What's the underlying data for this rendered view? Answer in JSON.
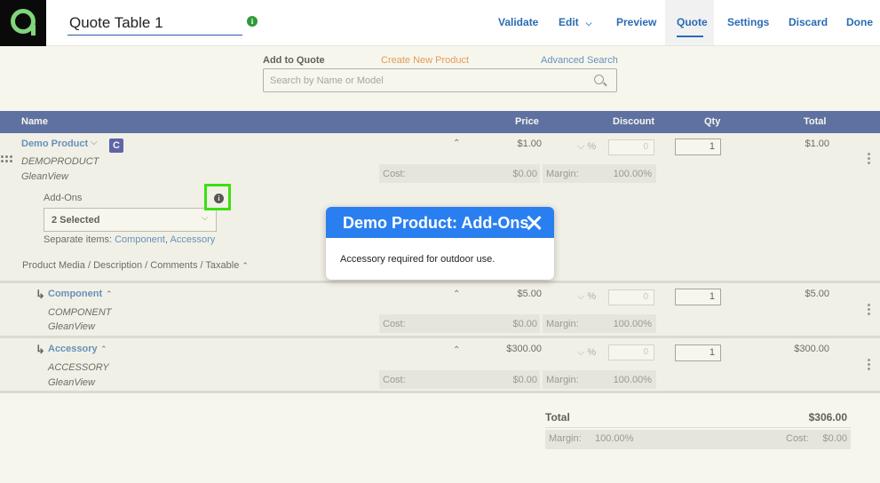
{
  "header": {
    "title_value": "Quote Table 1",
    "nav": {
      "validate": "Validate",
      "edit": "Edit",
      "preview": "Preview",
      "quote": "Quote",
      "settings": "Settings",
      "discard": "Discard",
      "done": "Done"
    },
    "active_tab": "Quote"
  },
  "add_to_quote": {
    "label": "Add to Quote",
    "create_new": "Create New Product",
    "advanced_search": "Advanced Search",
    "search_placeholder": "Search by Name or Model"
  },
  "table": {
    "headers": {
      "name": "Name",
      "price": "Price",
      "discount": "Discount",
      "qty": "Qty",
      "total": "Total"
    },
    "main_row": {
      "name": "Demo Product",
      "badge": "C",
      "model": "DEMOPRODUCT",
      "brand": "GleanView",
      "price": "$1.00",
      "discount_value": "0",
      "percent": "%",
      "qty": "1",
      "total": "$1.00",
      "cost_label": "Cost:",
      "cost": "$0.00",
      "margin_label": "Margin:",
      "margin": "100.00%",
      "addons_label": "Add-Ons",
      "addons_selected": "2 Selected",
      "separate_label": "Separate items:",
      "separate_component": "Component",
      "separate_sep": ",",
      "separate_accessory": "Accessory",
      "media_link": "Product Media / Description / Comments / Taxable"
    },
    "sub_rows": [
      {
        "name": "Component",
        "model": "COMPONENT",
        "brand": "GleanView",
        "price": "$5.00",
        "discount_value": "0",
        "percent": "%",
        "qty": "1",
        "total": "$5.00",
        "cost_label": "Cost:",
        "cost": "$0.00",
        "margin_label": "Margin:",
        "margin": "100.00%"
      },
      {
        "name": "Accessory",
        "model": "ACCESSORY",
        "brand": "GleanView",
        "price": "$300.00",
        "discount_value": "0",
        "percent": "%",
        "qty": "1",
        "total": "$300.00",
        "cost_label": "Cost:",
        "cost": "$0.00",
        "margin_label": "Margin:",
        "margin": "100.00%"
      }
    ]
  },
  "summary": {
    "total_label": "Total",
    "total_value": "$306.00",
    "margin_label": "Margin:",
    "margin_value": "100.00%",
    "cost_label": "Cost:",
    "cost_value": "$0.00"
  },
  "modal": {
    "title": "Demo Product: Add-Ons",
    "body": "Accessory required for outdoor use."
  },
  "colors": {
    "brand_navy": "#1f3c8f",
    "link_blue": "#2a6bb3",
    "modal_blue": "#2a7ff0",
    "highlight_green": "#3ae010",
    "logo_green": "#7fd67a"
  }
}
